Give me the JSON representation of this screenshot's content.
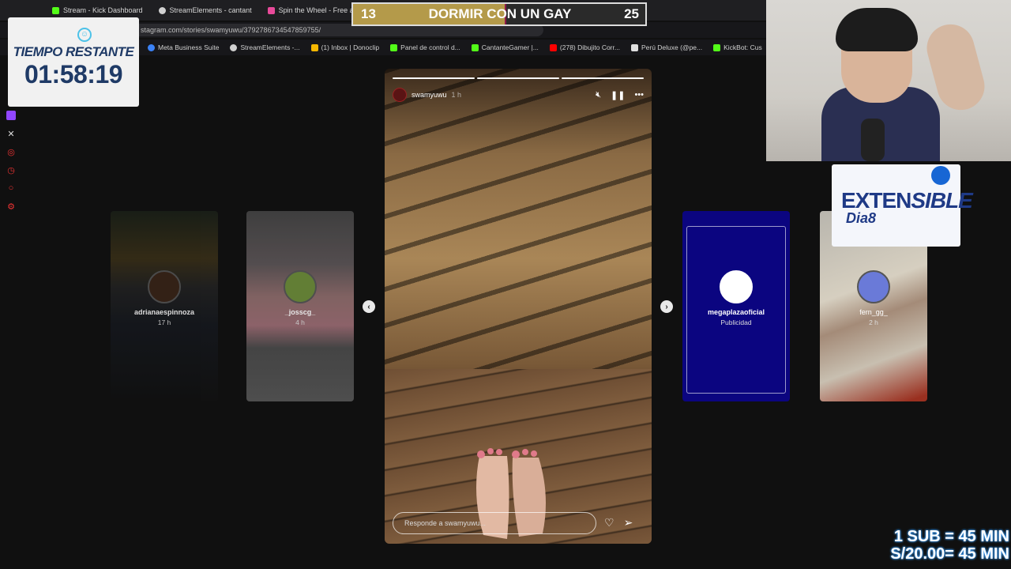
{
  "tabs": [
    {
      "label": "Stream - Kick Dashboard",
      "color": "#53fc18"
    },
    {
      "label": "StreamElements - cantant",
      "color": "#d0d0d0"
    },
    {
      "label": "Spin the Wheel - Free and",
      "color": "#e84a9a"
    }
  ],
  "url": "stagram.com/stories/swamyuwu/3792786734547859755/",
  "bookmarks": [
    {
      "label": "Meta Business Suite",
      "color": "#3b82f6"
    },
    {
      "label": "StreamElements -...",
      "color": "#d0d0d0"
    },
    {
      "label": "(1) Inbox | Donoclip",
      "color": "#f5b700"
    },
    {
      "label": "Panel de control d...",
      "color": "#53fc18"
    },
    {
      "label": "CantanteGamer |...",
      "color": "#53fc18"
    },
    {
      "label": "(278) Dibujito Corr...",
      "color": "#ff0000"
    },
    {
      "label": "Perú Deluxe (@pe...",
      "color": "#e0e0e0"
    },
    {
      "label": "KickBot: Cus",
      "color": "#53fc18"
    }
  ],
  "story": {
    "username": "swamyuwu",
    "time": "1 h",
    "reply_placeholder": "Responde a swamyuwu...",
    "progress_done": 3,
    "progress_total": 3
  },
  "side_stories": [
    {
      "name": "adrianaespinnoza",
      "time": "17 h"
    },
    {
      "name": "_josscg_",
      "time": "4 h"
    },
    {
      "name": "megaplazaoficial",
      "time": "Publicidad"
    },
    {
      "name": "fern_gg_",
      "time": "2 h"
    }
  ],
  "overlay": {
    "timer_label": "TIEMPO RESTANTE",
    "timer_value": "01:58:19",
    "goal_current": "13",
    "goal_text": "DORMIR CON UN GAY",
    "goal_target": "25",
    "ext_line1": "EXTEN",
    "ext_line1b": "SIBLE",
    "ext_line2": "Dia8",
    "sub_line1": "1 SUB = 45 MIN",
    "sub_line2": "S/20.00= 45 MIN"
  }
}
